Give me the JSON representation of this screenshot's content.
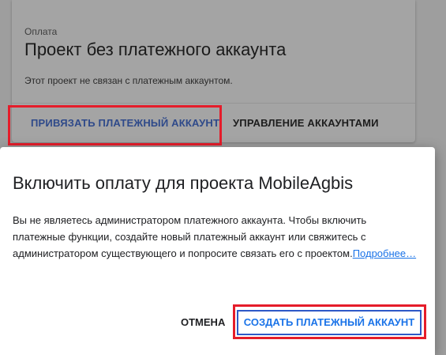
{
  "billing_card": {
    "overline": "Оплата",
    "title": "Проект без платежного аккаунта",
    "description": "Этот проект не связан с платежным аккаунтом.",
    "link_button": "ПРИВЯЗАТЬ ПЛАТЕЖНЫЙ АККАУНТ",
    "manage_button": "УПРАВЛЕНИЕ АККАУНТАМИ"
  },
  "dialog": {
    "title": "Включить оплату для проекта MobileAgbis",
    "body": "Вы не являетесь администратором платежного аккаунта. Чтобы включить платежные функции, создайте новый платежный аккаунт или свяжитесь с администратором существующего и попросите связать его с проектом.",
    "learn_more": "Подробнее…",
    "cancel_button": "ОТМЕНА",
    "create_button": "СОЗДАТЬ ПЛАТЕЖНЫЙ АККАУНТ"
  },
  "colors": {
    "highlight": "#e51c2a",
    "primary": "#1a73e8",
    "scrim": "#9e9e9e"
  }
}
